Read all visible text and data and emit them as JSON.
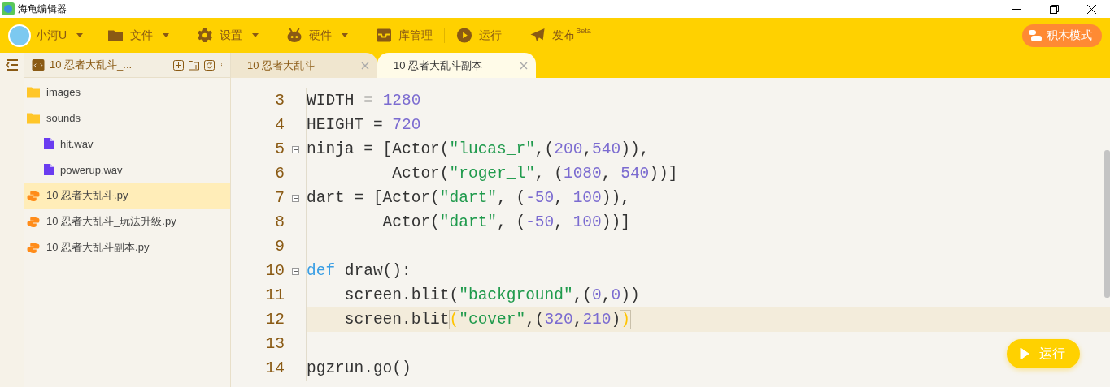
{
  "window": {
    "title": "海龟编辑器"
  },
  "toolbar": {
    "user": {
      "name": "小河U"
    },
    "menus": [
      {
        "label": "文件",
        "kind": "folder",
        "dropdown": true,
        "separator_before": false
      },
      {
        "label": "设置",
        "kind": "gear",
        "dropdown": true,
        "separator_before": false
      },
      {
        "label": "硬件",
        "kind": "robot",
        "dropdown": true,
        "separator_before": false
      },
      {
        "label": "库管理",
        "kind": "tray",
        "dropdown": false,
        "separator_before": false
      },
      {
        "label": "运行",
        "kind": "play",
        "dropdown": false,
        "separator_before": true
      },
      {
        "label": "发布",
        "kind": "send",
        "dropdown": false,
        "separator_before": false,
        "badge": "Beta"
      }
    ],
    "mode_button": {
      "label": "积木模式"
    }
  },
  "sidebar": {
    "project": "10 忍者大乱斗_...",
    "files": [
      {
        "name": "images",
        "kind": "folder",
        "selected": false
      },
      {
        "name": "sounds",
        "kind": "folder",
        "selected": false,
        "children": [
          {
            "name": "hit.wav",
            "kind": "file",
            "selected": false
          },
          {
            "name": "powerup.wav",
            "kind": "file",
            "selected": false
          }
        ]
      },
      {
        "name": "10 忍者大乱斗.py",
        "kind": "python",
        "selected": true
      },
      {
        "name": "10 忍者大乱斗_玩法升级.py",
        "kind": "python",
        "selected": false
      },
      {
        "name": "10 忍者大乱斗副本.py",
        "kind": "python",
        "selected": false
      }
    ]
  },
  "tabs": [
    {
      "label": "10 忍者大乱斗",
      "selected": false
    },
    {
      "label": "10 忍者大乱斗副本",
      "selected": true
    }
  ],
  "code": {
    "lines": [
      {
        "number": "3",
        "foldable": false,
        "current": false,
        "tokens": [
          {
            "kind": "plain",
            "t": "WIDTH = "
          },
          {
            "kind": "num",
            "t": "1280"
          }
        ]
      },
      {
        "number": "4",
        "foldable": false,
        "current": false,
        "tokens": [
          {
            "kind": "plain",
            "t": "HEIGHT = "
          },
          {
            "kind": "num",
            "t": "720"
          }
        ]
      },
      {
        "number": "5",
        "foldable": true,
        "current": false,
        "tokens": [
          {
            "kind": "plain",
            "t": "ninja = [Actor("
          },
          {
            "kind": "str",
            "t": "\"lucas_r\""
          },
          {
            "kind": "plain",
            "t": ",("
          },
          {
            "kind": "num",
            "t": "200"
          },
          {
            "kind": "plain",
            "t": ","
          },
          {
            "kind": "num",
            "t": "540"
          },
          {
            "kind": "plain",
            "t": ")),"
          }
        ]
      },
      {
        "number": "6",
        "foldable": false,
        "current": false,
        "tokens": [
          {
            "kind": "plain",
            "t": "         Actor("
          },
          {
            "kind": "str",
            "t": "\"roger_l\""
          },
          {
            "kind": "plain",
            "t": ", ("
          },
          {
            "kind": "num",
            "t": "1080"
          },
          {
            "kind": "plain",
            "t": ", "
          },
          {
            "kind": "num",
            "t": "540"
          },
          {
            "kind": "plain",
            "t": "))]"
          }
        ]
      },
      {
        "number": "7",
        "foldable": true,
        "current": false,
        "tokens": [
          {
            "kind": "plain",
            "t": "dart = [Actor("
          },
          {
            "kind": "str",
            "t": "\"dart\""
          },
          {
            "kind": "plain",
            "t": ", ("
          },
          {
            "kind": "num",
            "t": "-50"
          },
          {
            "kind": "plain",
            "t": ", "
          },
          {
            "kind": "num",
            "t": "100"
          },
          {
            "kind": "plain",
            "t": ")),"
          }
        ]
      },
      {
        "number": "8",
        "foldable": false,
        "current": false,
        "tokens": [
          {
            "kind": "plain",
            "t": "        Actor("
          },
          {
            "kind": "str",
            "t": "\"dart\""
          },
          {
            "kind": "plain",
            "t": ", ("
          },
          {
            "kind": "num",
            "t": "-50"
          },
          {
            "kind": "plain",
            "t": ", "
          },
          {
            "kind": "num",
            "t": "100"
          },
          {
            "kind": "plain",
            "t": "))]"
          }
        ]
      },
      {
        "number": "9",
        "foldable": false,
        "current": false
      },
      {
        "number": "10",
        "foldable": true,
        "current": false,
        "tokens": [
          {
            "kind": "kw",
            "t": "def"
          },
          {
            "kind": "plain",
            "t": " draw():"
          }
        ]
      },
      {
        "number": "11",
        "foldable": false,
        "current": false,
        "tokens": [
          {
            "kind": "plain",
            "t": "    screen.blit("
          },
          {
            "kind": "str",
            "t": "\"background\""
          },
          {
            "kind": "plain",
            "t": ",("
          },
          {
            "kind": "num",
            "t": "0"
          },
          {
            "kind": "plain",
            "t": ","
          },
          {
            "kind": "num",
            "t": "0"
          },
          {
            "kind": "plain",
            "t": "))"
          }
        ]
      },
      {
        "number": "12",
        "foldable": false,
        "current": true,
        "tokens": [
          {
            "kind": "plain",
            "t": "    screen.blit"
          },
          {
            "kind": "match",
            "t": "("
          },
          {
            "kind": "str",
            "t": "\"cover\""
          },
          {
            "kind": "plain",
            "t": ",("
          },
          {
            "kind": "num",
            "t": "320"
          },
          {
            "kind": "plain",
            "t": ","
          },
          {
            "kind": "num",
            "t": "210"
          },
          {
            "kind": "plain",
            "t": ")"
          },
          {
            "kind": "match",
            "t": ")"
          }
        ]
      },
      {
        "number": "13",
        "foldable": false,
        "current": false
      },
      {
        "number": "14",
        "foldable": false,
        "current": false,
        "tokens": [
          {
            "kind": "plain",
            "t": "pgzrun.go()"
          }
        ]
      }
    ]
  },
  "run_button": {
    "label": "运行"
  }
}
